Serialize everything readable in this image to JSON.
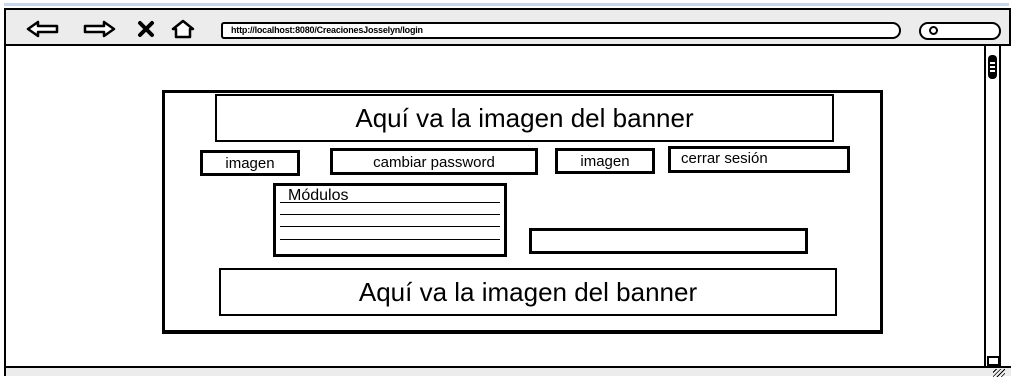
{
  "browser": {
    "address_url": "http://localhost:8080/CreacionesJosselyn/login",
    "nav_icons": [
      "back-arrow-icon",
      "forward-arrow-icon",
      "stop-icon",
      "home-icon"
    ],
    "search_icon": "search-icon"
  },
  "page": {
    "top_banner": "Aquí va la imagen del banner",
    "toolbar_buttons": {
      "imagen_left": "imagen",
      "change_password": "cambiar password",
      "imagen_right": "imagen",
      "logout": "cerrar sesión"
    },
    "modules": {
      "title": "Módulos",
      "items": [
        "",
        "",
        ""
      ]
    },
    "content_field": "",
    "bottom_banner": "Aquí va la imagen del banner"
  },
  "colors": {
    "chrome": "#ececec",
    "accent_strip": "#c9d6ea",
    "ink": "#000000"
  }
}
